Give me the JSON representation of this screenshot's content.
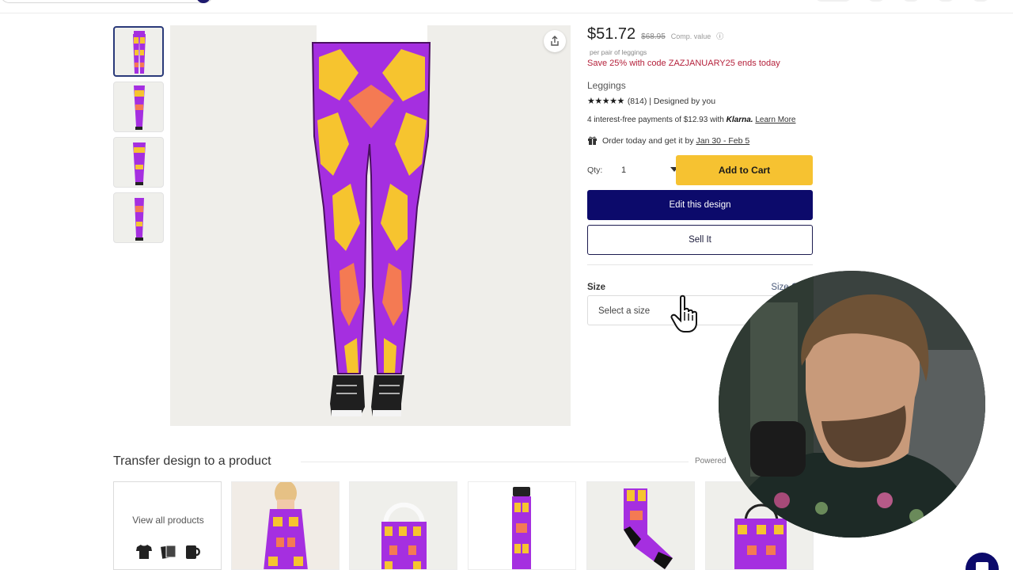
{
  "product": {
    "price": "$51.72",
    "comp_price": "$68.95",
    "comp_label": "Comp. value",
    "per_unit": "per pair of leggings",
    "promo": "Save 25% with code ZAZJANUARY25 ends today",
    "name": "Leggings",
    "stars": "★★★★★",
    "rating_text": "(814) | Designed by you",
    "klarna_prefix": "4 interest-free payments of $12.93 with",
    "klarna_brand": "Klarna.",
    "learn_more": "Learn More",
    "delivery_prefix": "Order today and get it by",
    "delivery_date": "Jan 30 - Feb 5",
    "qty_label": "Qty:",
    "qty_value": "1",
    "add_to_cart": "Add to Cart",
    "edit_design": "Edit this design",
    "sell_it": "Sell It",
    "size_label": "Size",
    "size_chart": "Size Chart",
    "size_placeholder": "Select a size"
  },
  "transfer": {
    "title": "Transfer design to a product",
    "powered": "Powered",
    "view_all": "View all products"
  },
  "colors": {
    "primary_navy": "#0c0a6b",
    "cart_yellow": "#f6c231",
    "promo_red": "#b5223c",
    "pattern_purple": "#a52fe0",
    "pattern_yellow": "#f6c42f",
    "pattern_orange": "#f47a53"
  },
  "icons": {
    "share": "share-icon",
    "info": "info-icon",
    "gift": "gift-icon",
    "caret": "chevron-down-icon",
    "cursor": "hand-pointer-icon"
  }
}
